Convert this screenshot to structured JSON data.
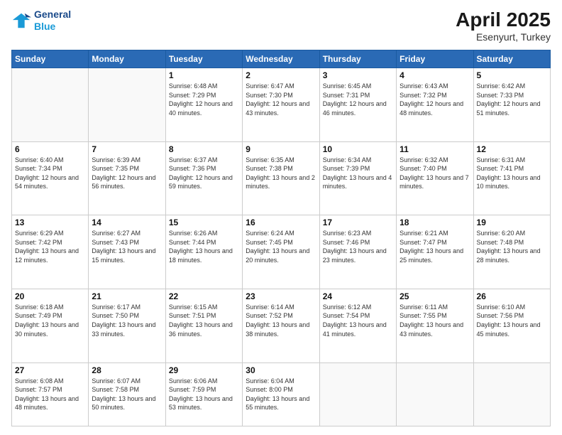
{
  "header": {
    "logo_line1": "General",
    "logo_line2": "Blue",
    "month_title": "April 2025",
    "location": "Esenyurt, Turkey"
  },
  "days_of_week": [
    "Sunday",
    "Monday",
    "Tuesday",
    "Wednesday",
    "Thursday",
    "Friday",
    "Saturday"
  ],
  "weeks": [
    [
      {
        "day": "",
        "info": ""
      },
      {
        "day": "",
        "info": ""
      },
      {
        "day": "1",
        "info": "Sunrise: 6:48 AM\nSunset: 7:29 PM\nDaylight: 12 hours and 40 minutes."
      },
      {
        "day": "2",
        "info": "Sunrise: 6:47 AM\nSunset: 7:30 PM\nDaylight: 12 hours and 43 minutes."
      },
      {
        "day": "3",
        "info": "Sunrise: 6:45 AM\nSunset: 7:31 PM\nDaylight: 12 hours and 46 minutes."
      },
      {
        "day": "4",
        "info": "Sunrise: 6:43 AM\nSunset: 7:32 PM\nDaylight: 12 hours and 48 minutes."
      },
      {
        "day": "5",
        "info": "Sunrise: 6:42 AM\nSunset: 7:33 PM\nDaylight: 12 hours and 51 minutes."
      }
    ],
    [
      {
        "day": "6",
        "info": "Sunrise: 6:40 AM\nSunset: 7:34 PM\nDaylight: 12 hours and 54 minutes."
      },
      {
        "day": "7",
        "info": "Sunrise: 6:39 AM\nSunset: 7:35 PM\nDaylight: 12 hours and 56 minutes."
      },
      {
        "day": "8",
        "info": "Sunrise: 6:37 AM\nSunset: 7:36 PM\nDaylight: 12 hours and 59 minutes."
      },
      {
        "day": "9",
        "info": "Sunrise: 6:35 AM\nSunset: 7:38 PM\nDaylight: 13 hours and 2 minutes."
      },
      {
        "day": "10",
        "info": "Sunrise: 6:34 AM\nSunset: 7:39 PM\nDaylight: 13 hours and 4 minutes."
      },
      {
        "day": "11",
        "info": "Sunrise: 6:32 AM\nSunset: 7:40 PM\nDaylight: 13 hours and 7 minutes."
      },
      {
        "day": "12",
        "info": "Sunrise: 6:31 AM\nSunset: 7:41 PM\nDaylight: 13 hours and 10 minutes."
      }
    ],
    [
      {
        "day": "13",
        "info": "Sunrise: 6:29 AM\nSunset: 7:42 PM\nDaylight: 13 hours and 12 minutes."
      },
      {
        "day": "14",
        "info": "Sunrise: 6:27 AM\nSunset: 7:43 PM\nDaylight: 13 hours and 15 minutes."
      },
      {
        "day": "15",
        "info": "Sunrise: 6:26 AM\nSunset: 7:44 PM\nDaylight: 13 hours and 18 minutes."
      },
      {
        "day": "16",
        "info": "Sunrise: 6:24 AM\nSunset: 7:45 PM\nDaylight: 13 hours and 20 minutes."
      },
      {
        "day": "17",
        "info": "Sunrise: 6:23 AM\nSunset: 7:46 PM\nDaylight: 13 hours and 23 minutes."
      },
      {
        "day": "18",
        "info": "Sunrise: 6:21 AM\nSunset: 7:47 PM\nDaylight: 13 hours and 25 minutes."
      },
      {
        "day": "19",
        "info": "Sunrise: 6:20 AM\nSunset: 7:48 PM\nDaylight: 13 hours and 28 minutes."
      }
    ],
    [
      {
        "day": "20",
        "info": "Sunrise: 6:18 AM\nSunset: 7:49 PM\nDaylight: 13 hours and 30 minutes."
      },
      {
        "day": "21",
        "info": "Sunrise: 6:17 AM\nSunset: 7:50 PM\nDaylight: 13 hours and 33 minutes."
      },
      {
        "day": "22",
        "info": "Sunrise: 6:15 AM\nSunset: 7:51 PM\nDaylight: 13 hours and 36 minutes."
      },
      {
        "day": "23",
        "info": "Sunrise: 6:14 AM\nSunset: 7:52 PM\nDaylight: 13 hours and 38 minutes."
      },
      {
        "day": "24",
        "info": "Sunrise: 6:12 AM\nSunset: 7:54 PM\nDaylight: 13 hours and 41 minutes."
      },
      {
        "day": "25",
        "info": "Sunrise: 6:11 AM\nSunset: 7:55 PM\nDaylight: 13 hours and 43 minutes."
      },
      {
        "day": "26",
        "info": "Sunrise: 6:10 AM\nSunset: 7:56 PM\nDaylight: 13 hours and 45 minutes."
      }
    ],
    [
      {
        "day": "27",
        "info": "Sunrise: 6:08 AM\nSunset: 7:57 PM\nDaylight: 13 hours and 48 minutes."
      },
      {
        "day": "28",
        "info": "Sunrise: 6:07 AM\nSunset: 7:58 PM\nDaylight: 13 hours and 50 minutes."
      },
      {
        "day": "29",
        "info": "Sunrise: 6:06 AM\nSunset: 7:59 PM\nDaylight: 13 hours and 53 minutes."
      },
      {
        "day": "30",
        "info": "Sunrise: 6:04 AM\nSunset: 8:00 PM\nDaylight: 13 hours and 55 minutes."
      },
      {
        "day": "",
        "info": ""
      },
      {
        "day": "",
        "info": ""
      },
      {
        "day": "",
        "info": ""
      }
    ]
  ]
}
